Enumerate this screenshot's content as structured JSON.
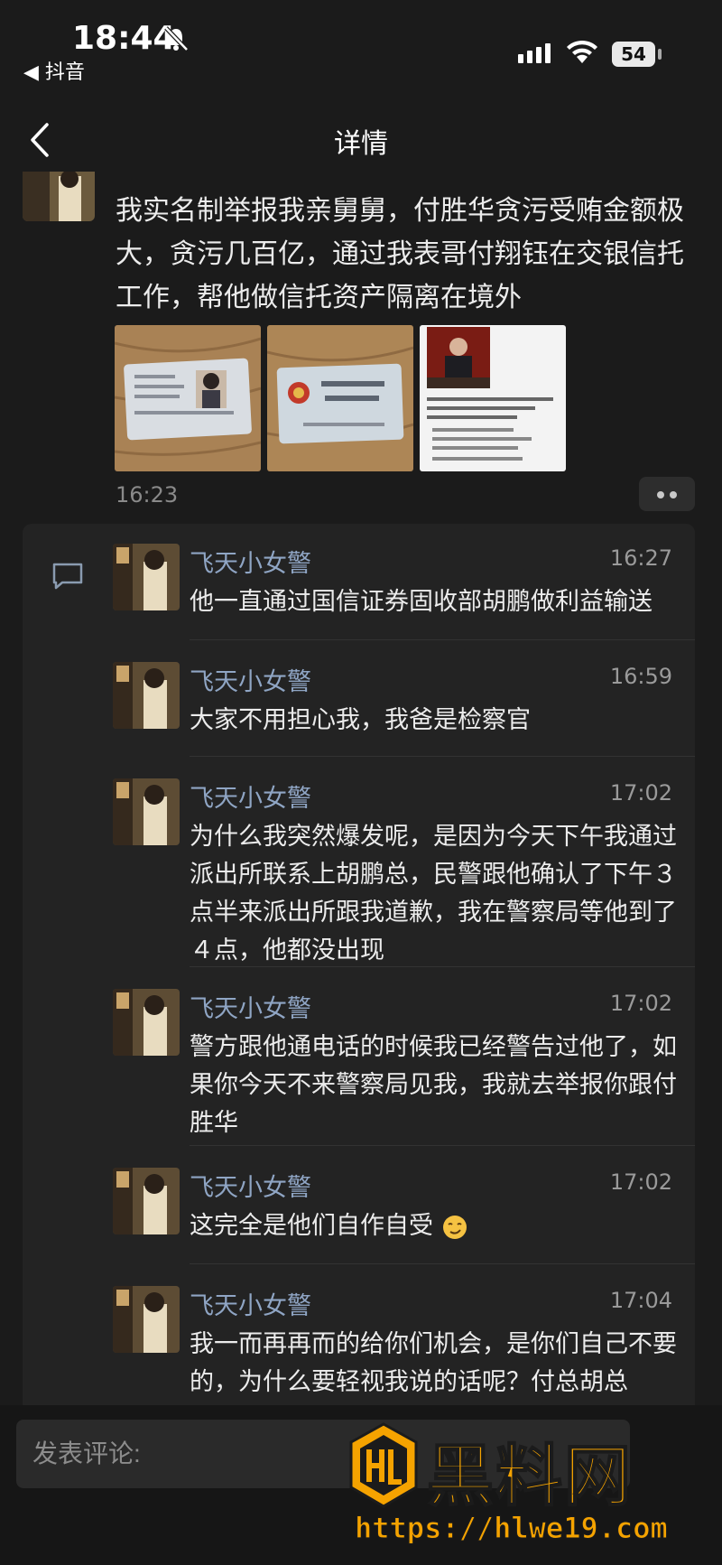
{
  "status_bar": {
    "time": "18:44",
    "back_app": "◀ 抖音",
    "battery": "54"
  },
  "nav": {
    "title": "详情"
  },
  "post": {
    "text": "我实名制举报我亲舅舅，付胜华贪污受贿金额极大，贪污几百亿，通过我表哥付翔钰在交银信托工作，帮他做信托资产隔离在境外",
    "time": "16:23",
    "images": [
      "id-card-front-photo",
      "id-card-back-photo",
      "profile-document-screenshot"
    ]
  },
  "comments": [
    {
      "name": "飞天小女警",
      "time": "16:27",
      "text": "他一直通过国信证券固收部胡鹏做利益输送"
    },
    {
      "name": "飞天小女警",
      "time": "16:59",
      "text": "大家不用担心我，我爸是检察官"
    },
    {
      "name": "飞天小女警",
      "time": "17:02",
      "text": "为什么我突然爆发呢，是因为今天下午我通过派出所联系上胡鹏总，民警跟他确认了下午３点半来派出所跟我道歉，我在警察局等他到了４点，他都没出现"
    },
    {
      "name": "飞天小女警",
      "time": "17:02",
      "text": "警方跟他通电话的时候我已经警告过他了，如果你今天不来警察局见我，我就去举报你跟付胜华"
    },
    {
      "name": "飞天小女警",
      "time": "17:02",
      "text": "这完全是他们自作自受",
      "emoji": "smirk-emoji"
    },
    {
      "name": "飞天小女警",
      "time": "17:04",
      "text": "我一而再再而的给你们机会，是你们自己不要的，为什么要轻视我说的话呢？付总胡总"
    }
  ],
  "input": {
    "placeholder": "发表评论:"
  },
  "watermark": {
    "name": "黑料网",
    "url": "https://hlwe19.com"
  },
  "colors": {
    "background": "#1b1b1b",
    "panel": "#232323",
    "username": "#8fa5c4",
    "watermark": "#f5a300"
  }
}
